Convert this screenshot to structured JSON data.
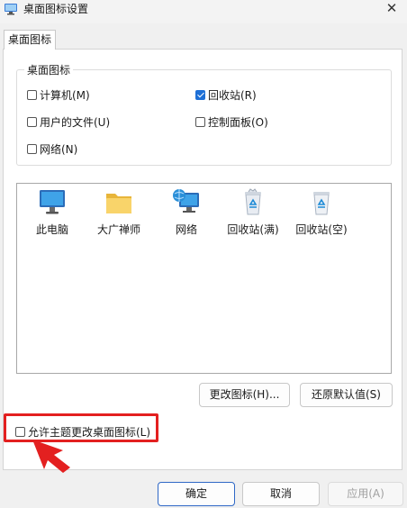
{
  "window": {
    "title": "桌面图标设置",
    "close_glyph": "✕"
  },
  "tabs": [
    {
      "label": "桌面图标"
    }
  ],
  "group": {
    "legend": "桌面图标",
    "checkboxes": {
      "computer": {
        "label": "计算机(M)",
        "checked": false
      },
      "recycle": {
        "label": "回收站(R)",
        "checked": true
      },
      "user_files": {
        "label": "用户的文件(U)",
        "checked": false
      },
      "control_panel": {
        "label": "控制面板(O)",
        "checked": false
      },
      "network": {
        "label": "网络(N)",
        "checked": false
      }
    }
  },
  "icons": [
    {
      "label": "此电脑",
      "icon": "monitor-icon"
    },
    {
      "label": "大广禅师",
      "icon": "folder-icon"
    },
    {
      "label": "网络",
      "icon": "network-icon"
    },
    {
      "label": "回收站(满)",
      "icon": "recycle-bin-full-icon"
    },
    {
      "label": "回收站(空)",
      "icon": "recycle-bin-empty-icon"
    }
  ],
  "buttons": {
    "change_icon": "更改图标(H)...",
    "restore_default": "还原默认值(S)",
    "ok": "确定",
    "cancel": "取消",
    "apply": "应用(A)"
  },
  "theme_checkbox": {
    "label": "允许主题更改桌面图标(L)",
    "checked": false
  },
  "colors": {
    "accent": "#1d6fd6",
    "highlight": "#e32020"
  }
}
